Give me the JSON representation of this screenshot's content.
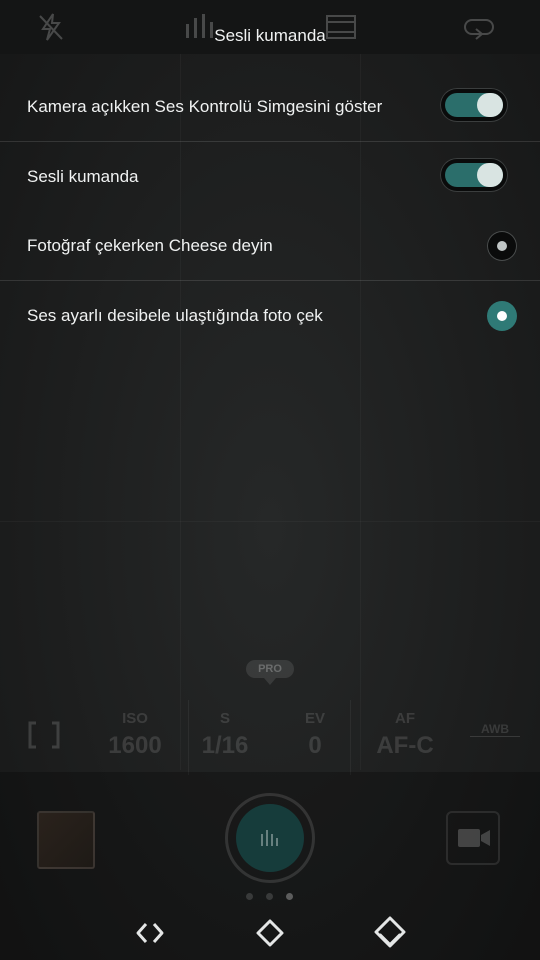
{
  "header": {
    "title": "Sesli kumanda"
  },
  "settings": [
    {
      "label": "Kamera açıkken Ses Kontrolü Simgesini göster",
      "control": "toggle",
      "state": "on"
    },
    {
      "label": "Sesli kumanda",
      "control": "toggle",
      "state": "on"
    },
    {
      "label": "Fotoğraf çekerken Cheese deyin",
      "control": "radio",
      "state": "off"
    },
    {
      "label": "Ses ayarlı desibele ulaştığında foto çek",
      "control": "radio",
      "state": "on"
    }
  ],
  "pro_mode": {
    "badge": "PRO",
    "params": [
      {
        "name": "ISO",
        "value": "1600"
      },
      {
        "name": "S",
        "value": "1/16"
      },
      {
        "name": "EV",
        "value": "0"
      },
      {
        "name": "AF",
        "value": "AF-C"
      }
    ],
    "awb": "AWB"
  },
  "colors": {
    "accent": "#2b6e6b",
    "background": "#1c1d1d",
    "text": "#f0f2f2"
  },
  "icons": [
    "flash-off-icon",
    "levels-icon",
    "film-icon",
    "switch-camera-icon",
    "metering-icon",
    "video-camera-icon",
    "back-icon",
    "home-icon",
    "recents-icon"
  ]
}
